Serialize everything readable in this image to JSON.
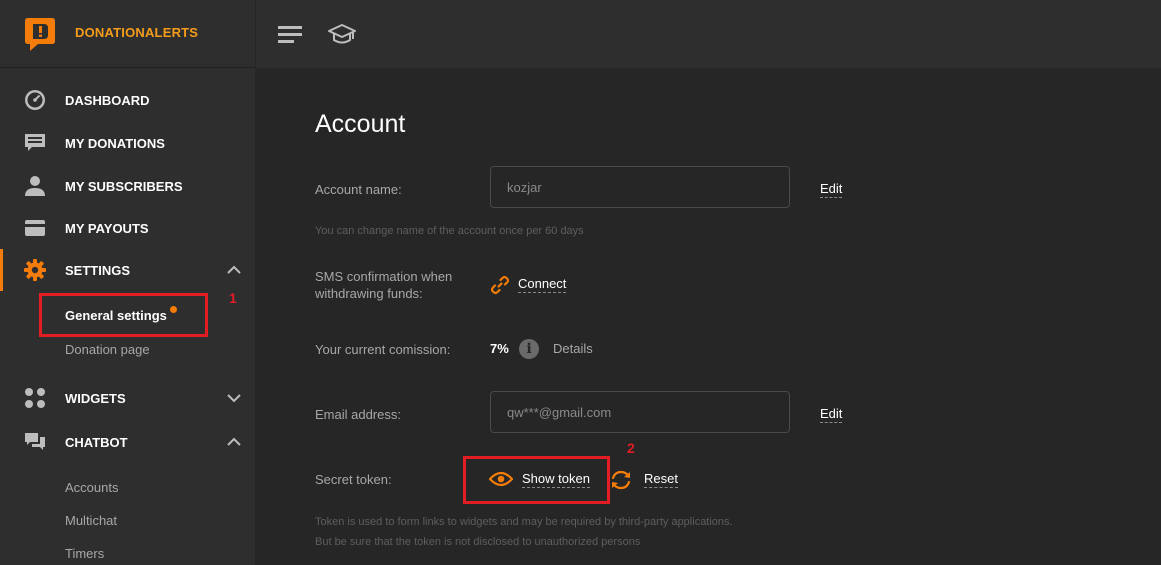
{
  "brand": {
    "name": "DONATIONALERTS"
  },
  "colors": {
    "accent": "#f57d07",
    "annotation": "#e21d24"
  },
  "sidebar": {
    "items": [
      {
        "label": "DASHBOARD",
        "icon": "dashboard-gauge-icon"
      },
      {
        "label": "MY DONATIONS",
        "icon": "chat-lines-icon"
      },
      {
        "label": "MY SUBSCRIBERS",
        "icon": "person-icon"
      },
      {
        "label": "MY PAYOUTS",
        "icon": "wallet-card-icon"
      },
      {
        "label": "SETTINGS",
        "icon": "gear-icon"
      },
      {
        "label": "WIDGETS",
        "icon": "grid-dots-icon"
      },
      {
        "label": "CHATBOT",
        "icon": "chat-bubbles-icon"
      }
    ],
    "settings_sub": [
      "General settings",
      "Donation page"
    ],
    "chatbot_sub": [
      "Accounts",
      "Multichat",
      "Timers"
    ]
  },
  "topbar": {
    "icons": [
      "menu-icon",
      "graduation-cap-icon"
    ]
  },
  "account": {
    "title": "Account",
    "name_label": "Account name:",
    "name_value": "kozjar",
    "edit_label": "Edit",
    "name_hint": "You can change name of the account once per 60 days",
    "sms_label_line1": "SMS confirmation when",
    "sms_label_line2": "withdrawing funds:",
    "connect_label": "Connect",
    "commission_label": "Your current comission:",
    "commission_value": "7%",
    "details_label": "Details",
    "email_label": "Email address:",
    "email_placeholder": "qw***@gmail.com",
    "email_edit_label": "Edit",
    "token_label": "Secret token:",
    "show_token_label": "Show token",
    "reset_label": "Reset",
    "token_hint_line1": "Token is used to form links to widgets and may be required by third-party applications.",
    "token_hint_line2": "But be sure that the token is not disclosed to unauthorized persons"
  },
  "annotations": {
    "one": "1",
    "two": "2"
  }
}
